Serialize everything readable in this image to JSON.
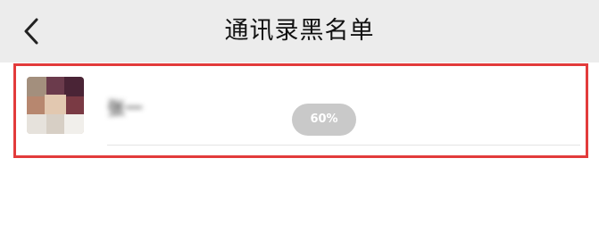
{
  "header": {
    "title": "通讯录黑名单",
    "back_icon": "chevron-left-icon"
  },
  "blacklist": {
    "items": [
      {
        "name": "张一",
        "avatar": "contact-avatar"
      }
    ]
  },
  "overlay": {
    "progress_text": "60%",
    "progress_fraction": 0.6
  },
  "colors": {
    "header_bg": "#ececec",
    "highlight_border": "#e23b3b",
    "pill_bg": "#c9c9c9"
  }
}
